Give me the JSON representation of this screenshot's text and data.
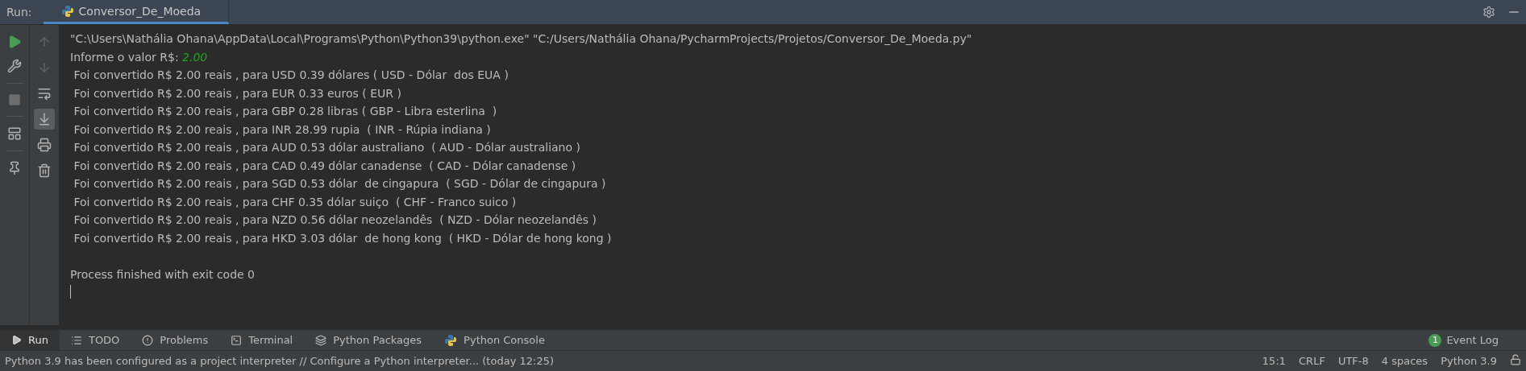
{
  "run_bar": {
    "label": "Run:",
    "tab": {
      "title": "Conversor_De_Moeda",
      "selected": true
    }
  },
  "gutter_actions": [
    {
      "kind": "run"
    },
    {
      "kind": "wrench"
    },
    {
      "kind": "stop",
      "disabled": true
    },
    {
      "kind": "layout"
    },
    {
      "kind": "pin"
    }
  ],
  "console_toolbar": [
    {
      "kind": "up",
      "disabled": true,
      "selected": false
    },
    {
      "kind": "down",
      "disabled": true,
      "selected": false
    },
    {
      "kind": "wrap",
      "disabled": false,
      "selected": false
    },
    {
      "kind": "scroll-end",
      "disabled": false,
      "selected": true
    },
    {
      "kind": "print",
      "disabled": false,
      "selected": false
    },
    {
      "kind": "trash",
      "disabled": false,
      "selected": false
    }
  ],
  "console": [
    {
      "kind": "command",
      "text": "\"C:\\Users\\Nathália Ohana\\AppData\\Local\\Programs\\Python\\Python39\\python.exe\" \"C:/Users/Nathália Ohana/PycharmProjects/Projetos/Conversor_De_Moeda.py\""
    },
    {
      "kind": "prompt",
      "text": "Informe o valor R$: ",
      "input": "2.00"
    },
    {
      "kind": "output",
      "text": " Foi convertido R$ 2.00 reais , para USD 0.39 dólares ( USD - Dólar  dos EUA )"
    },
    {
      "kind": "output",
      "text": " Foi convertido R$ 2.00 reais , para EUR 0.33 euros ( EUR )"
    },
    {
      "kind": "output",
      "text": " Foi convertido R$ 2.00 reais , para GBP 0.28 libras ( GBP - Libra esterlina  )"
    },
    {
      "kind": "output",
      "text": " Foi convertido R$ 2.00 reais , para INR 28.99 rupia  ( INR - Rúpia indiana )"
    },
    {
      "kind": "output",
      "text": " Foi convertido R$ 2.00 reais , para AUD 0.53 dólar australiano  ( AUD - Dólar australiano )"
    },
    {
      "kind": "output",
      "text": " Foi convertido R$ 2.00 reais , para CAD 0.49 dólar canadense  ( CAD - Dólar canadense )"
    },
    {
      "kind": "output",
      "text": " Foi convertido R$ 2.00 reais , para SGD 0.53 dólar  de cingapura  ( SGD - Dólar de cingapura )"
    },
    {
      "kind": "output",
      "text": " Foi convertido R$ 2.00 reais , para CHF 0.35 dólar suiço  ( CHF - Franco suico )"
    },
    {
      "kind": "output",
      "text": " Foi convertido R$ 2.00 reais , para NZD 0.56 dólar neozelandês  ( NZD - Dólar neozelandês )"
    },
    {
      "kind": "output",
      "text": " Foi convertido R$ 2.00 reais , para HKD 3.03 dólar  de hong kong  ( HKD - Dólar de hong kong )"
    },
    {
      "kind": "exit",
      "text": "Process finished with exit code 0"
    }
  ],
  "tool_tabs": [
    {
      "label": "Run",
      "kind": "run",
      "selected": true
    },
    {
      "label": "TODO",
      "kind": "list",
      "selected": false
    },
    {
      "label": "Problems",
      "kind": "alert",
      "selected": false
    },
    {
      "label": "Terminal",
      "kind": "terminal",
      "selected": false
    },
    {
      "label": "Python Packages",
      "kind": "layers",
      "selected": false
    },
    {
      "label": "Python Console",
      "kind": "python",
      "selected": false
    }
  ],
  "event_log": {
    "count": "1",
    "label": "Event Log"
  },
  "status_bar": {
    "message": "Python 3.9 has been configured as a project interpreter // Configure a Python interpreter... (today 12:25)",
    "items": [
      "15:1",
      "CRLF",
      "UTF-8",
      "4 spaces",
      "Python 3.9"
    ]
  }
}
